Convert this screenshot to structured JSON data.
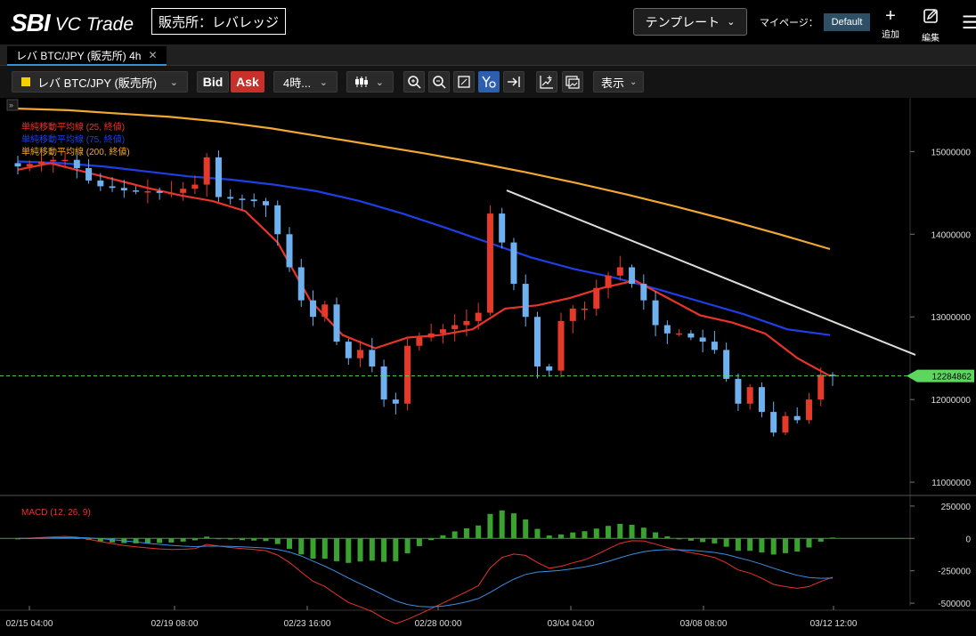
{
  "header": {
    "logo_sbi": "SBI",
    "logo_vc": "VC Trade",
    "exchange_label": "販売所：レバレッジ",
    "template_label": "テンプレート",
    "mypage_label": "マイページ：",
    "default_badge": "Default",
    "add_label": "追加",
    "edit_label": "編集"
  },
  "tab": {
    "label": "レバ BTC/JPY (販売所) 4h"
  },
  "toolbar": {
    "symbol": "レバ BTC/JPY (販売所)",
    "bid_label": "Bid",
    "ask_label": "Ask",
    "interval": "4時...",
    "display_label": "表示"
  },
  "legend": {
    "sma25": "単純移動平均線 (25, 終値)",
    "sma75": "単純移動平均線 (75, 終値)",
    "sma200": "単純移動平均線 (200, 終値)",
    "macd": "MACD (12, 26, 9)"
  },
  "colors": {
    "up": "#e53a2a",
    "down": "#6fb0ef",
    "sma25": "#e8342a",
    "sma75": "#1f3fe6",
    "sma200": "#f0a832",
    "hist": "#3aa330",
    "current": "#5cd65c"
  },
  "chart_data": {
    "type": "candlestick",
    "symbol": "レバ BTC/JPY (販売所)",
    "interval": "4h",
    "price_axis": [
      "15000000",
      "14000000",
      "13000000",
      "12000000",
      "11000000"
    ],
    "price_range": [
      10850000,
      15650000
    ],
    "current_price": "12284862",
    "time_labels": [
      "02/15 04:00",
      "02/19 08:00",
      "02/23 16:00",
      "02/28 00:00",
      "03/04 04:00",
      "03/08 08:00",
      "03/12 12:00"
    ],
    "macd_axis": [
      "250000",
      "0",
      "-250000",
      "-500000"
    ],
    "macd_range": [
      -520000,
      270000
    ],
    "closes_approx": [
      14820000,
      14850000,
      14880000,
      14900000,
      14900000,
      14800000,
      14650000,
      14580000,
      14560000,
      14530000,
      14520000,
      14520000,
      14500000,
      14500000,
      14550000,
      14600000,
      14930000,
      14450000,
      14430000,
      14420000,
      14400000,
      14350000,
      14000000,
      13600000,
      13200000,
      13000000,
      13150000,
      12700000,
      12500000,
      12600000,
      12400000,
      12000000,
      11950000,
      12650000,
      12750000,
      12800000,
      12850000,
      12900000,
      12950000,
      13050000,
      14250000,
      13900000,
      13400000,
      13000000,
      12400000,
      12350000,
      12950000,
      13100000,
      13100000,
      13350000,
      13500000,
      13600000,
      13400000,
      13200000,
      12900000,
      12800000,
      12800000,
      12750000,
      12700000,
      12600000,
      12250000,
      11950000,
      12150000,
      11850000,
      11600000,
      11800000,
      11750000,
      12000000,
      12300000,
      12284862
    ],
    "sma200_series": [
      15520000,
      15500000,
      15460000,
      15420000,
      15360000,
      15280000,
      15180000,
      15080000,
      14980000,
      14870000,
      14750000,
      14620000,
      14480000,
      14330000,
      14170000,
      14000000,
      13820000
    ],
    "sma75_series": [
      14880000,
      14860000,
      14820000,
      14760000,
      14700000,
      14660000,
      14600000,
      14520000,
      14400000,
      14250000,
      14080000,
      13900000,
      13720000,
      13580000,
      13470000,
      13330000,
      13180000,
      13030000,
      12850000,
      12780000
    ],
    "sma25_series": [
      14780000,
      14860000,
      14760000,
      14660000,
      14560000,
      14470000,
      14400000,
      14280000,
      13900000,
      13200000,
      12780000,
      12620000,
      12750000,
      12780000,
      12850000,
      13100000,
      13140000,
      13230000,
      13350000,
      13440000,
      13230000,
      13020000,
      12930000,
      12800000,
      12500000,
      12284862
    ],
    "trendline": {
      "from_price": 14530000,
      "to_price": 12540000
    }
  }
}
